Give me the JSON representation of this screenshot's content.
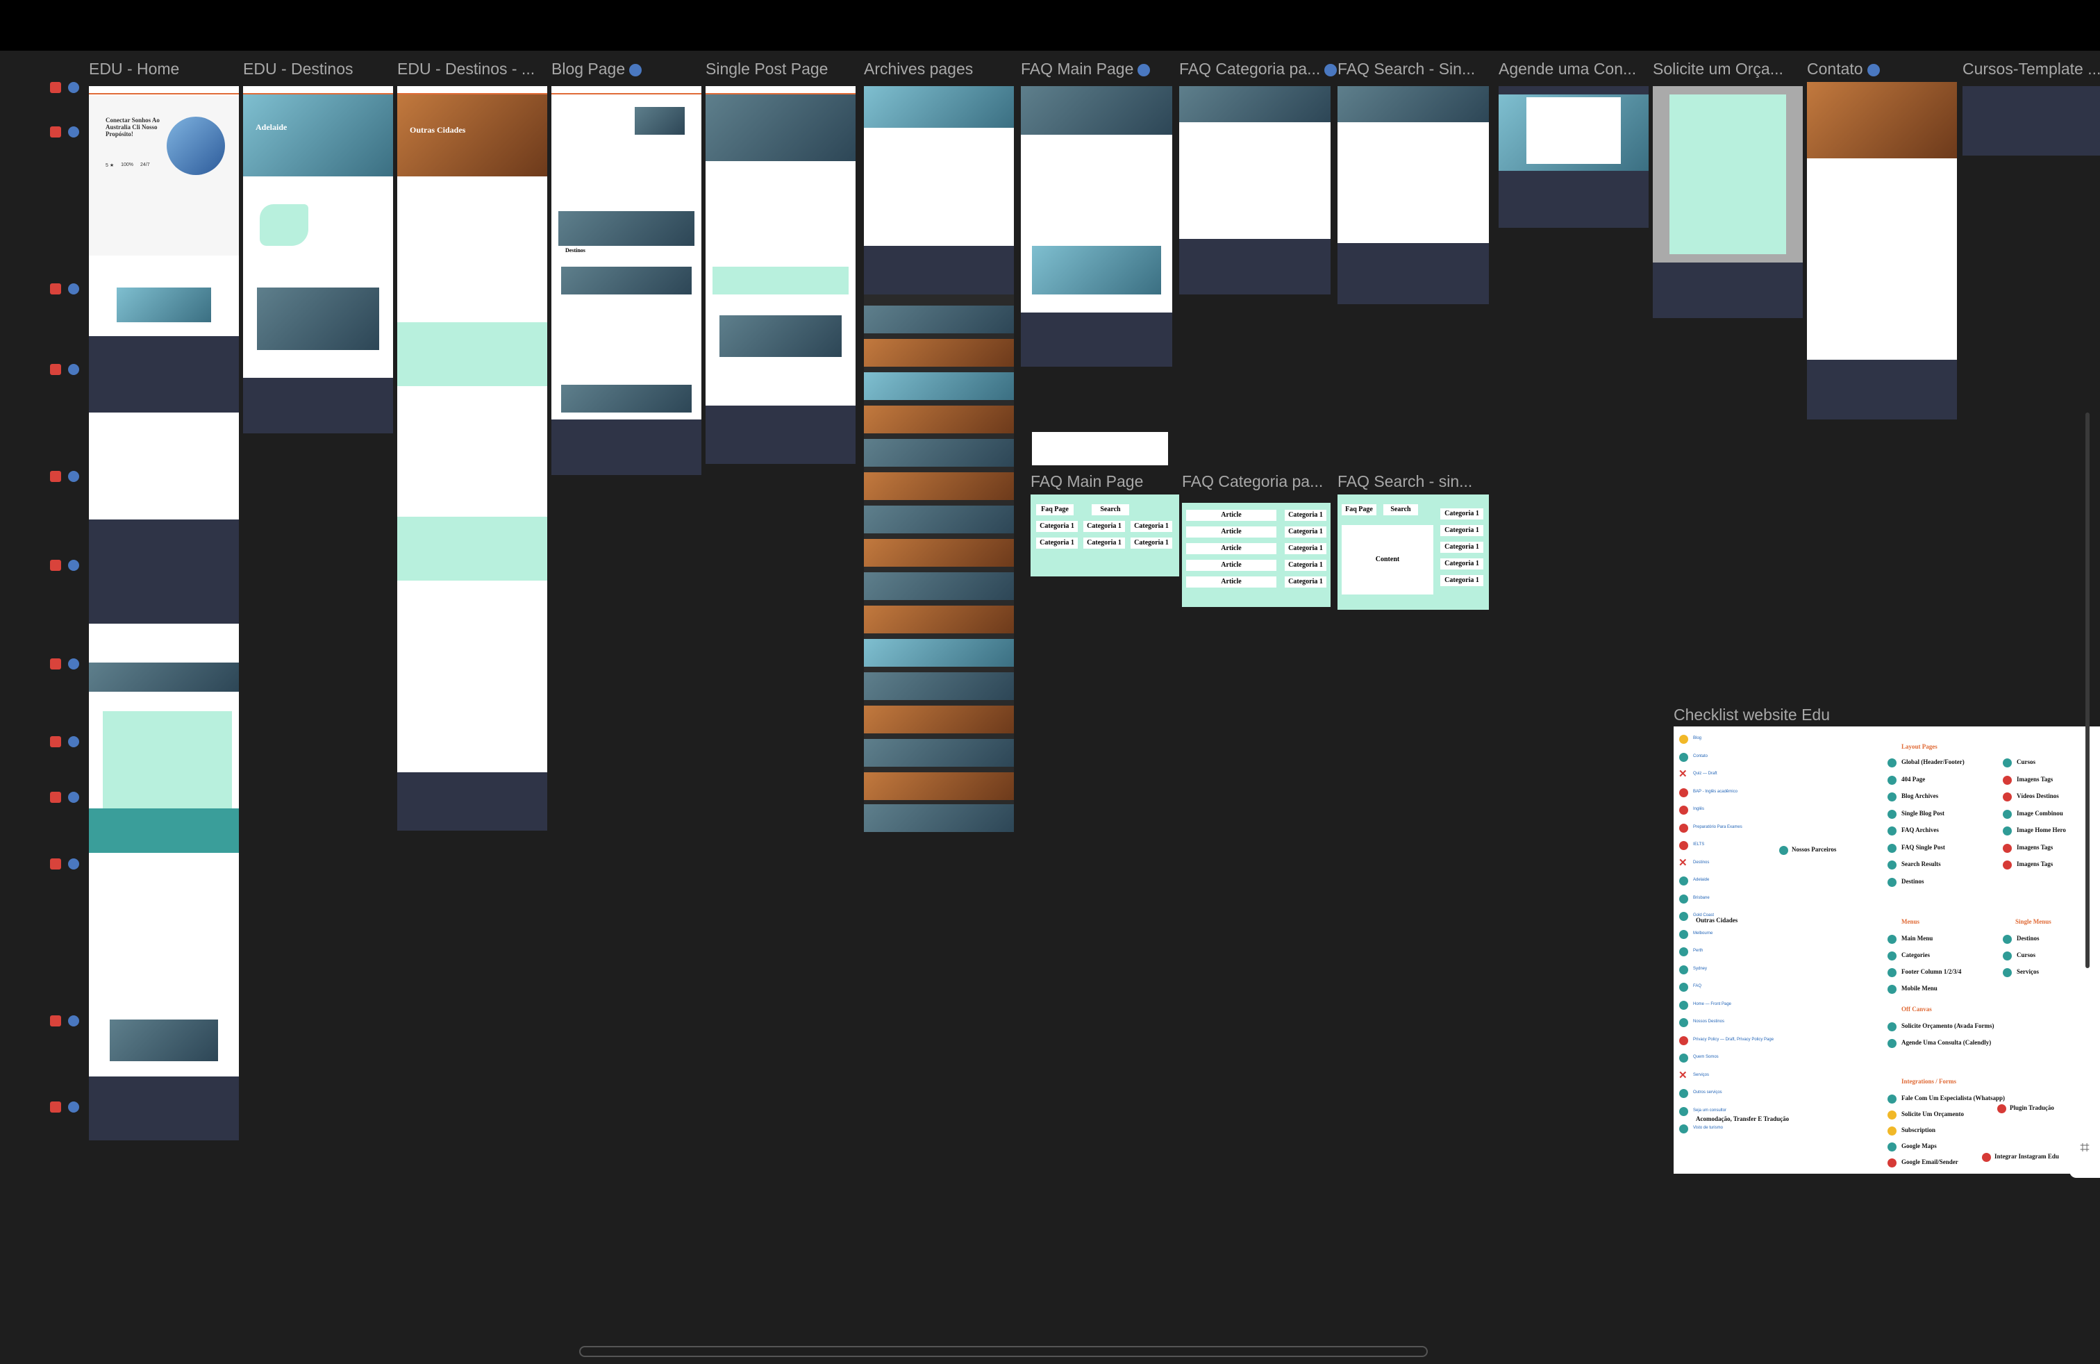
{
  "frames": [
    {
      "title": "EDU - Home"
    },
    {
      "title": "EDU - Destinos"
    },
    {
      "title": "EDU - Destinos - ..."
    },
    {
      "title": "Blog Page"
    },
    {
      "title": "Single Post Page"
    },
    {
      "title": "Archives pages"
    },
    {
      "title": "FAQ Main Page"
    },
    {
      "title": "FAQ Categoria pa..."
    },
    {
      "title": "FAQ Search - Sin..."
    },
    {
      "title": "Agende uma Con..."
    },
    {
      "title": "Solicite um Orça..."
    },
    {
      "title": "Contato"
    },
    {
      "title": "Cursos-Template ..."
    }
  ],
  "wireframes": {
    "main": {
      "title": "FAQ Main Page",
      "faq_page": "Faq Page",
      "search": "Search",
      "category": "Categoria 1"
    },
    "categoria": {
      "title": "FAQ Categoria pa...",
      "article": "Article",
      "category": "Categoria 1"
    },
    "search": {
      "title": "FAQ Search - sin...",
      "faq_page": "Faq Page",
      "search": "Search",
      "content": "Content",
      "category": "Categoria 1"
    }
  },
  "home_previews": {
    "hero_title": "Conectar Sonhos Ao Australia Cli Nosso Propósito!",
    "hero_stats": [
      "5 ★",
      "100%",
      "24/7"
    ],
    "adelaide": "Adelaide",
    "outras_cidades": "Outras Cidades",
    "destinos": "Destinos"
  },
  "checklist": {
    "title": "Checklist website Edu",
    "layout_pages_label": "Layout Pages",
    "menus_label": "Menus",
    "single_menus_label": "Single Menus",
    "off_canvas_label": "Off Canvas",
    "integrations_label": "Integrations / Forms",
    "left_items": [
      {
        "text": "Blog",
        "status": "yellow"
      },
      {
        "text": "Contato",
        "status": "teal"
      },
      {
        "text": "Quiz — Draft",
        "status": "x"
      },
      {
        "text": "BAP - Inglês acadêmico",
        "status": "red"
      },
      {
        "text": "Inglês",
        "status": "red"
      },
      {
        "text": "Preparatório Para Exames",
        "status": "red"
      },
      {
        "text": "IELTS",
        "status": "red"
      },
      {
        "text": "Destinos",
        "status": "x"
      },
      {
        "text": "Adelaide",
        "status": "teal"
      },
      {
        "text": "Brisbane",
        "status": "teal"
      },
      {
        "text": "Gold Coast",
        "status": "teal"
      },
      {
        "text": "Melbourne",
        "status": "teal"
      },
      {
        "text": "Perth",
        "status": "teal"
      },
      {
        "text": "Sydney",
        "status": "teal"
      },
      {
        "text": "FAQ",
        "status": "teal"
      },
      {
        "text": "Home — Front Page",
        "status": "teal"
      },
      {
        "text": "Nossos Destinos",
        "status": "teal"
      },
      {
        "text": "Privacy Policy — Draft, Privacy Policy Page",
        "status": "red"
      },
      {
        "text": "Quem Somos",
        "status": "teal"
      },
      {
        "text": "Serviços",
        "status": "x"
      },
      {
        "text": "Outros serviços",
        "status": "teal"
      },
      {
        "text": "Seja um consultor",
        "status": "teal"
      },
      {
        "text": "Visto de turismo",
        "status": "teal"
      }
    ],
    "nossos_parceiros": "Nossos Parceiros",
    "outras_cidades": "Outras Cidades",
    "acomodacao": "Acomodação, Transfer E Tradução",
    "layout_items": [
      "Global (Header/Footer)",
      "404 Page",
      "Blog Archives",
      "Single Blog Post",
      "FAQ Archives",
      "FAQ Single Post",
      "Search Results",
      "Destinos"
    ],
    "layout_right_items": [
      {
        "text": "Cursos",
        "status": "teal"
      },
      {
        "text": "Imagens Tags",
        "status": "red"
      },
      {
        "text": "Vídeos Destinos",
        "status": "red"
      },
      {
        "text": "Image Combinou",
        "status": "teal"
      },
      {
        "text": "Image Home Hero",
        "status": "teal"
      },
      {
        "text": "Imagens Tags",
        "status": "red"
      },
      {
        "text": "Imagens Tags",
        "status": "red"
      }
    ],
    "menu_items": [
      "Main Menu",
      "Categories",
      "Footer Column 1/2/3/4",
      "Mobile Menu"
    ],
    "single_menu_items": [
      "Destinos",
      "Cursos",
      "Serviços"
    ],
    "off_canvas_items": [
      "Solicite Orçamento (Avada Forms)",
      "Agende Uma Consulta (Calendly)"
    ],
    "integration_items": [
      {
        "text": "Fale Com Um Especialista (Whatsapp)",
        "status": "teal"
      },
      {
        "text": "Solicite Um Orçamento",
        "status": "yellow"
      },
      {
        "text": "Subscription",
        "status": "yellow"
      },
      {
        "text": "Google Maps",
        "status": "teal"
      },
      {
        "text": "Google Email/Sender",
        "status": "red"
      }
    ],
    "plugin_traducao": "Plugin Tradução",
    "instagram": "Integrar Instagram Edu"
  },
  "colors": {
    "canvas": "#1e1e1e",
    "mint": "#b8f0dd",
    "navy": "#2f3447",
    "orange": "#e06b37",
    "teal": "#2f9b96",
    "red": "#d63a36",
    "yellow": "#f1b828"
  },
  "icons": {
    "frame_badge": "wordpress-icon",
    "row_badges": [
      "figma-icon",
      "wordpress-icon"
    ]
  }
}
